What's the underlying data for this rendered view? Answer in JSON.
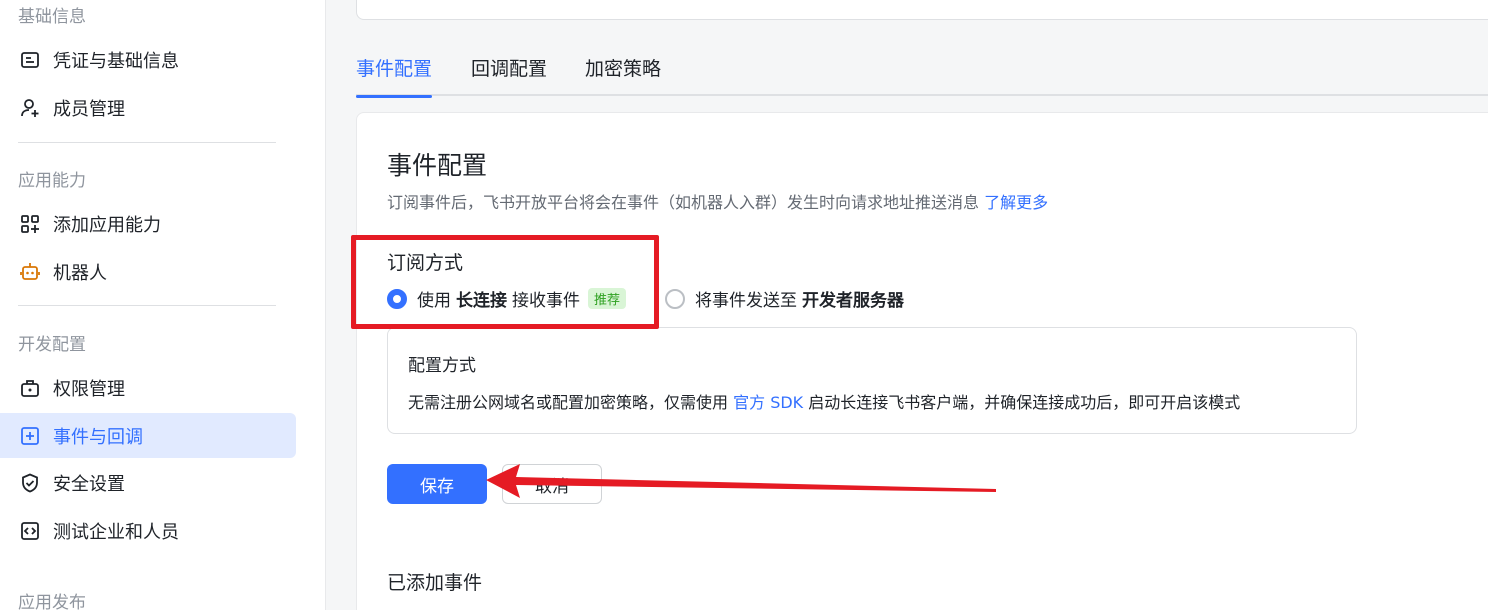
{
  "sidebar": {
    "sections": [
      {
        "title": "基础信息"
      },
      {
        "title": "应用能力"
      },
      {
        "title": "开发配置"
      },
      {
        "title": "应用发布"
      }
    ],
    "items": [
      {
        "label": "凭证与基础信息",
        "icon": "credential-icon"
      },
      {
        "label": "成员管理",
        "icon": "user-add-icon"
      },
      {
        "label": "添加应用能力",
        "icon": "app-grid-add-icon"
      },
      {
        "label": "机器人",
        "icon": "robot-icon"
      },
      {
        "label": "权限管理",
        "icon": "lock-briefcase-icon"
      },
      {
        "label": "事件与回调",
        "icon": "event-plus-icon",
        "active": true
      },
      {
        "label": "安全设置",
        "icon": "shield-check-icon"
      },
      {
        "label": "测试企业和人员",
        "icon": "code-icon"
      }
    ]
  },
  "tabs": [
    {
      "label": "事件配置",
      "active": true
    },
    {
      "label": "回调配置"
    },
    {
      "label": "加密策略"
    }
  ],
  "main": {
    "title": "事件配置",
    "description": "订阅事件后，飞书开放平台将会在事件（如机器人入群）发生时向请求地址推送消息",
    "learn_more": "了解更多",
    "subscription_label": "订阅方式",
    "option_long_conn": {
      "prefix": "使用",
      "bold": "长连接",
      "suffix": "接收事件",
      "badge": "推荐",
      "checked": true
    },
    "option_server": {
      "prefix": "将事件发送至",
      "bold": "开发者服务器",
      "checked": false
    },
    "config_box": {
      "title": "配置方式",
      "text_before": "无需注册公网域名或配置加密策略，仅需使用",
      "link": "官方 SDK",
      "text_after": "启动长连接飞书客户端，并确保连接成功后，即可开启该模式"
    },
    "save_label": "保存",
    "cancel_label": "取消",
    "added_events_title": "已添加事件"
  },
  "colors": {
    "accent": "#3370ff",
    "annotation": "#e51b24",
    "badge_bg": "#d9f5d6",
    "badge_text": "#2ea121"
  }
}
